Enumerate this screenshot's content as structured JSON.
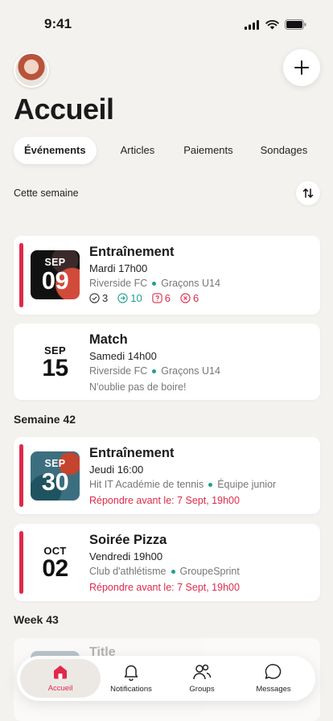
{
  "status_bar": {
    "time": "9:41"
  },
  "header": {
    "title": "Accueil"
  },
  "tabs": [
    {
      "label": "Événements",
      "active": true
    },
    {
      "label": "Articles",
      "active": false
    },
    {
      "label": "Paiements",
      "active": false
    },
    {
      "label": "Sondages",
      "active": false
    }
  ],
  "filter": {
    "label": "Cette semaine"
  },
  "sections": [
    {
      "label": "Semaine 42"
    },
    {
      "label": "Week 43"
    }
  ],
  "events": [
    {
      "month": "SEP",
      "day": "09",
      "title": "Entraînement",
      "time": "Mardi 17h00",
      "club": "Riverside FC",
      "team": "Graçons U14",
      "stats": {
        "going": "3",
        "invited": "10",
        "unknown": "6",
        "declined": "6"
      }
    },
    {
      "month": "SEP",
      "day": "15",
      "title": "Match",
      "time": "Samedi 14h00",
      "club": "Riverside FC",
      "team": "Graçons U14",
      "note": "N'oublie pas de boire!"
    },
    {
      "month": "SEP",
      "day": "30",
      "title": "Entraînement",
      "time": "Jeudi 16:00",
      "club": "Hit IT Académie de tennis",
      "team": "Équipe junior",
      "deadline": "Répondre avant le: 7 Sept, 19h00"
    },
    {
      "month": "OCT",
      "day": "02",
      "title": "Soirée Pizza",
      "time": "Vendredi 19h00",
      "club": "Club d'athlétisme",
      "team": "GroupeSprint",
      "deadline": "Répondre avant le: 7 Sept, 19h00"
    },
    {
      "title": "Title"
    }
  ],
  "bottom_nav": [
    {
      "label": "Accueil",
      "icon": "home-icon",
      "active": true
    },
    {
      "label": "Notifications",
      "icon": "bell-icon",
      "active": false
    },
    {
      "label": "Groups",
      "icon": "users-icon",
      "active": false
    },
    {
      "label": "Messages",
      "icon": "message-icon",
      "active": false
    }
  ],
  "colors": {
    "accent": "#e0294a",
    "teal": "#1f9e91",
    "background": "#f4f2ef"
  }
}
